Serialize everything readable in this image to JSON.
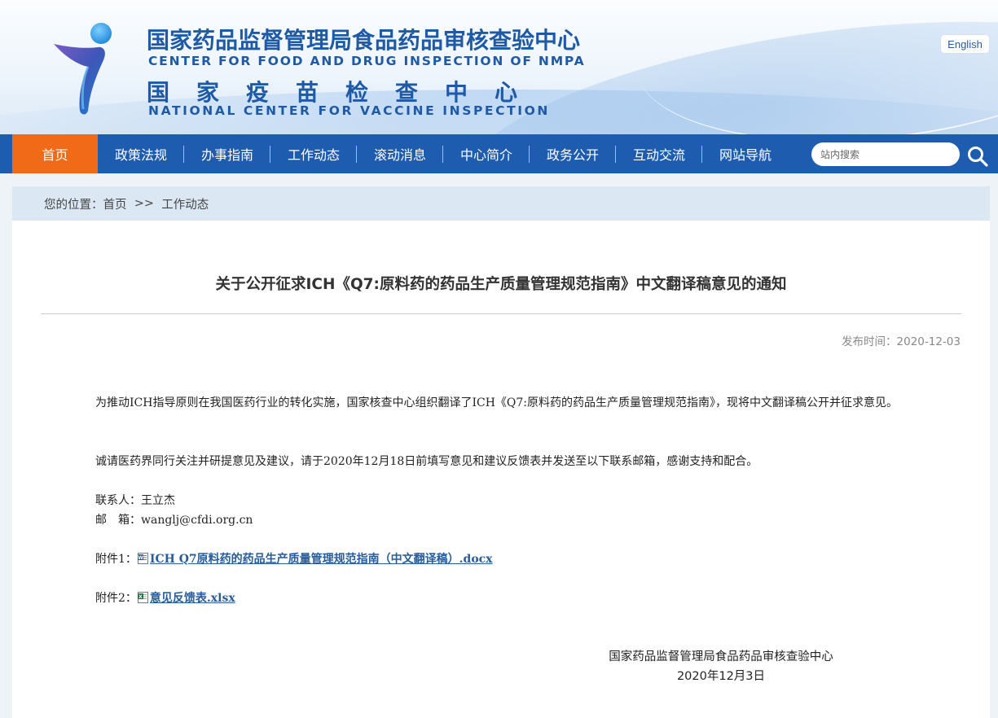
{
  "header": {
    "title_zh": "国家药品监督管理局食品药品审核查验中心",
    "title_en": "CENTER FOR FOOD AND DRUG INSPECTION OF NMPA",
    "subtitle_zh": "国家疫苗检查中心",
    "subtitle_en": "NATIONAL CENTER FOR VACCINE INSPECTION",
    "english_link": "English",
    "brand_color": "#1f5aa6"
  },
  "nav": {
    "items": [
      {
        "label": "首页",
        "active": true
      },
      {
        "label": "政策法规"
      },
      {
        "label": "办事指南"
      },
      {
        "label": "工作动态"
      },
      {
        "label": "滚动消息"
      },
      {
        "label": "中心简介"
      },
      {
        "label": "政务公开"
      },
      {
        "label": "互动交流"
      },
      {
        "label": "网站导航"
      }
    ],
    "search_placeholder": "站内搜索",
    "nav_color": "#1e5cb0",
    "active_color": "#f06a17"
  },
  "breadcrumb": {
    "prefix": "您的位置：",
    "home": "首页",
    "separator": "  >>  ",
    "current": "工作动态"
  },
  "article": {
    "title": "关于公开征求ICH《Q7:原料药的药品生产质量管理规范指南》中文翻译稿意见的通知",
    "publish_time": "发布时间：2020-12-03",
    "paragraph1": "为推动ICH指导原则在我国医药行业的转化实施，国家核查中心组织翻译了ICH《Q7:原料药的药品生产质量管理规范指南》，现将中文翻译稿公开并征求意见。",
    "paragraph2": "诚请医药界同行关注并研提意见及建议，请于2020年12月18日前填写意见和建议反馈表并发送至以下联系邮箱，感谢支持和配合。",
    "contact_label": "联系人：",
    "contact_name": "王立杰",
    "email_label": "邮　箱：",
    "email": "wanglj@cfdi.org.cn",
    "attachments": [
      {
        "label": "附件1：",
        "file": "ICH Q7原料药的药品生产质量管理规范指南（中文翻译稿）.docx",
        "icon": "word-doc-icon"
      },
      {
        "label": "附件2：",
        "file": "意见反馈表.xlsx",
        "icon": "excel-sheet-icon"
      }
    ],
    "signature_org": "国家药品监督管理局食品药品审核查验中心",
    "signature_date": "2020年12月3日"
  }
}
